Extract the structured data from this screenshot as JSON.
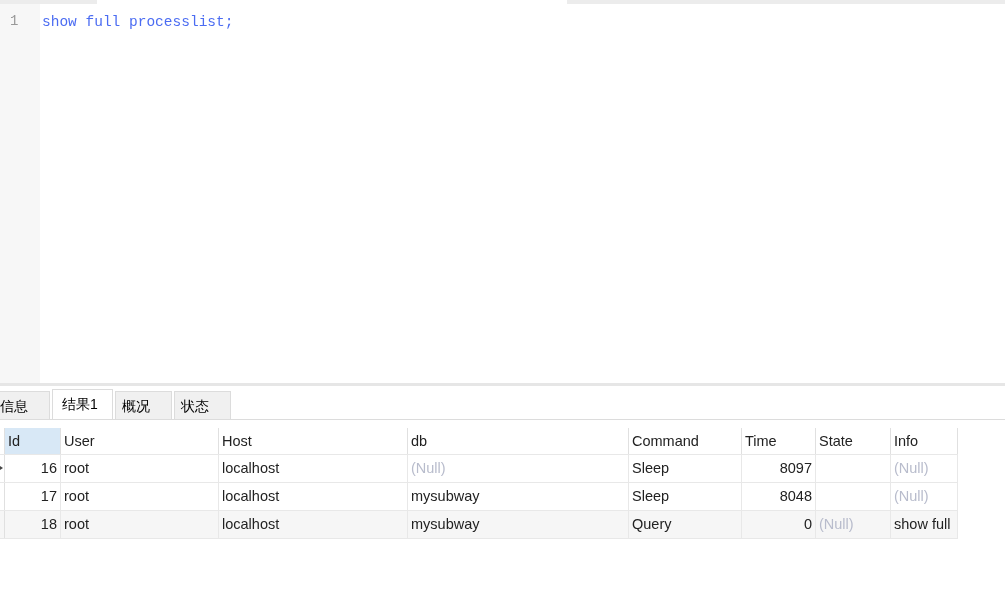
{
  "editor": {
    "lines": [
      {
        "number": "1",
        "code": "show full processlist;"
      }
    ]
  },
  "result_tabs": [
    {
      "label": "信息",
      "selected": false
    },
    {
      "label": "结果1",
      "selected": true
    },
    {
      "label": "概况",
      "selected": false
    },
    {
      "label": "状态",
      "selected": false
    }
  ],
  "table": {
    "columns": [
      {
        "label": "Id",
        "selected": true,
        "kind": "number"
      },
      {
        "label": "User",
        "selected": false,
        "kind": "text"
      },
      {
        "label": "Host",
        "selected": false,
        "kind": "text"
      },
      {
        "label": "db",
        "selected": false,
        "kind": "text"
      },
      {
        "label": "Command",
        "selected": false,
        "kind": "text"
      },
      {
        "label": "Time",
        "selected": false,
        "kind": "number"
      },
      {
        "label": "State",
        "selected": false,
        "kind": "text"
      },
      {
        "label": "Info",
        "selected": false,
        "kind": "text"
      }
    ],
    "rows": [
      {
        "current": true,
        "cells": [
          {
            "text": "16"
          },
          {
            "text": "root"
          },
          {
            "text": "localhost"
          },
          {
            "text": "(Null)",
            "null": true
          },
          {
            "text": "Sleep"
          },
          {
            "text": "8097"
          },
          null,
          {
            "text": "(Null)",
            "null": true
          }
        ]
      },
      {
        "current": false,
        "cells": [
          {
            "text": "17"
          },
          {
            "text": "root"
          },
          {
            "text": "localhost"
          },
          {
            "text": "mysubway"
          },
          {
            "text": "Sleep"
          },
          {
            "text": "8048"
          },
          null,
          {
            "text": "(Null)",
            "null": true
          }
        ]
      },
      {
        "current": false,
        "cells": [
          {
            "text": "18"
          },
          {
            "text": "root"
          },
          {
            "text": "localhost"
          },
          {
            "text": "mysubway"
          },
          {
            "text": "Query"
          },
          {
            "text": "0"
          },
          {
            "text": "(Null)",
            "null": true
          },
          {
            "text": "show full"
          }
        ]
      }
    ]
  }
}
